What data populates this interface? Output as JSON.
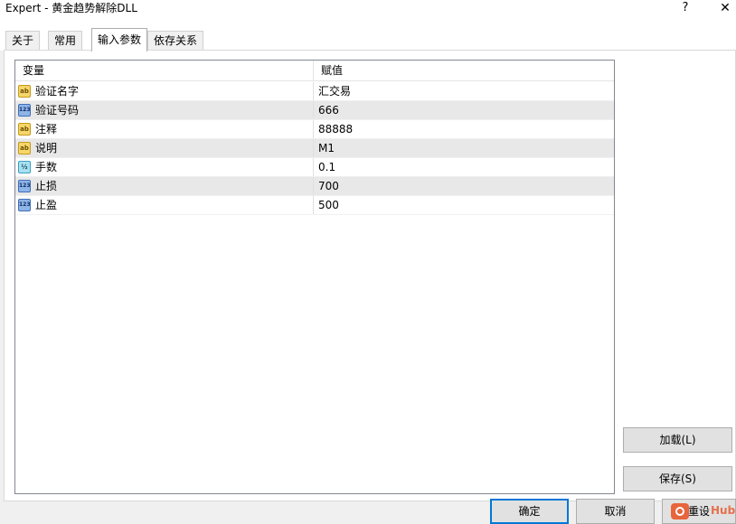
{
  "window": {
    "title": "Expert - 黄金趋势解除DLL",
    "help_glyph": "?",
    "close_glyph": "✕"
  },
  "tabs": [
    {
      "label": "关于",
      "active": false
    },
    {
      "label": "常用",
      "active": false
    },
    {
      "label": "输入参数",
      "active": true
    },
    {
      "label": "依存关系",
      "active": false
    }
  ],
  "grid": {
    "columns": {
      "name": "变量",
      "value": "赋值"
    },
    "rows": [
      {
        "icon": "string-type-icon",
        "icon_text": "ab",
        "name": "验证名字",
        "value": "汇交易"
      },
      {
        "icon": "integer-type-icon",
        "icon_text": "123",
        "name": "验证号码",
        "value": "666"
      },
      {
        "icon": "string-type-icon",
        "icon_text": "ab",
        "name": "注释",
        "value": "88888"
      },
      {
        "icon": "string-type-icon",
        "icon_text": "ab",
        "name": "说明",
        "value": "M1"
      },
      {
        "icon": "double-type-icon",
        "icon_text": "½",
        "name": "手数",
        "value": "0.1"
      },
      {
        "icon": "integer-type-icon",
        "icon_text": "123",
        "name": "止损",
        "value": "700"
      },
      {
        "icon": "integer-type-icon",
        "icon_text": "123",
        "name": "止盈",
        "value": "500"
      }
    ]
  },
  "buttons": {
    "load": "加载(L)",
    "save": "保存(S)",
    "ok": "确定",
    "cancel": "取消",
    "reset": "重设"
  },
  "watermark": {
    "text": "Hub",
    "color": "#e8643c"
  },
  "colors": {
    "accent": "#0078d7",
    "alt_row": "#e8e8e8"
  }
}
